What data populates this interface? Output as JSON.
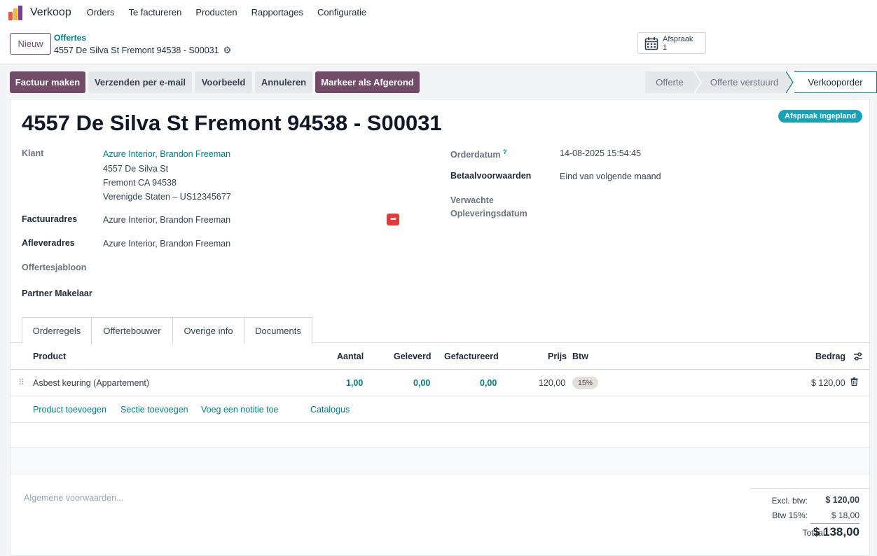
{
  "navbar": {
    "app_name": "Verkoop",
    "menu": [
      "Orders",
      "Te factureren",
      "Producten",
      "Rapportages",
      "Configuratie"
    ],
    "logo_colors": [
      "#e65a3e",
      "#f5b536",
      "#7c3c9a"
    ]
  },
  "control": {
    "new_label": "Nieuw",
    "breadcrumb_parent": "Offertes",
    "breadcrumb_current": "4557 De Silva St Fremont 94538 - S00031",
    "smart_button": {
      "label": "Afspraak",
      "count": "1"
    }
  },
  "actions": {
    "create_invoice": "Factuur maken",
    "send_email": "Verzenden per e-mail",
    "preview": "Voorbeeld",
    "cancel": "Annuleren",
    "mark_done": "Markeer als Afgerond"
  },
  "status": {
    "stages": [
      "Offerte",
      "Offerte verstuurd",
      "Verkooporder"
    ],
    "active": "Verkooporder"
  },
  "sheet": {
    "title": "4557 De Silva St Fremont 94538 - S00031",
    "ribbon": "Afspraak ingepland",
    "customer_label": "Klant",
    "customer_name": "Azure Interior, Brandon Freeman",
    "customer_address": [
      "4557 De Silva St",
      "Fremont CA 94538",
      "Verenigde Staten – US12345677"
    ],
    "invoice_address_label": "Factuuradres",
    "invoice_address": "Azure Interior, Brandon Freeman",
    "delivery_address_label": "Afleveradres",
    "delivery_address": "Azure Interior, Brandon Freeman",
    "template_label": "Offertesjabloon",
    "partner_label": "Partner Makelaar",
    "order_date_label": "Orderdatum",
    "order_date_help": "?",
    "order_date": "14-08-2025 15:54:45",
    "payment_terms_label": "Betaalvoorwaarden",
    "payment_terms": "Eind van volgende maand",
    "expected_delivery_label_1": "Verwachte",
    "expected_delivery_label_2": "Opleveringsdatum"
  },
  "tabs": [
    "Orderregels",
    "Offertebouwer",
    "Overige info",
    "Documents"
  ],
  "table": {
    "headers": {
      "product": "Product",
      "quantity": "Aantal",
      "delivered": "Geleverd",
      "invoiced": "Gefactureerd",
      "price": "Prijs",
      "tax": "Btw",
      "amount": "Bedrag"
    },
    "rows": [
      {
        "product": "Asbest keuring (Appartement)",
        "quantity": "1,00",
        "delivered": "0,00",
        "invoiced": "0,00",
        "price": "120,00",
        "tax": "15%",
        "amount": "$ 120,00"
      }
    ],
    "add_links": [
      "Product toevoegen",
      "Sectie toevoegen",
      "Voeg een notitie toe",
      "Catalogus"
    ]
  },
  "footer": {
    "terms_placeholder": "Algemene voorwaarden...",
    "excl_label": "Excl. btw:",
    "excl_value": "$ 120,00",
    "tax_label": "Btw 15%:",
    "tax_value": "$ 18,00",
    "total_label": "Totaal:",
    "total_value": "$ 138,00"
  },
  "colors": {
    "primary": "#714b67",
    "link": "#017e84",
    "ribbon": "#17a2b8",
    "danger": "#e03b3b"
  }
}
